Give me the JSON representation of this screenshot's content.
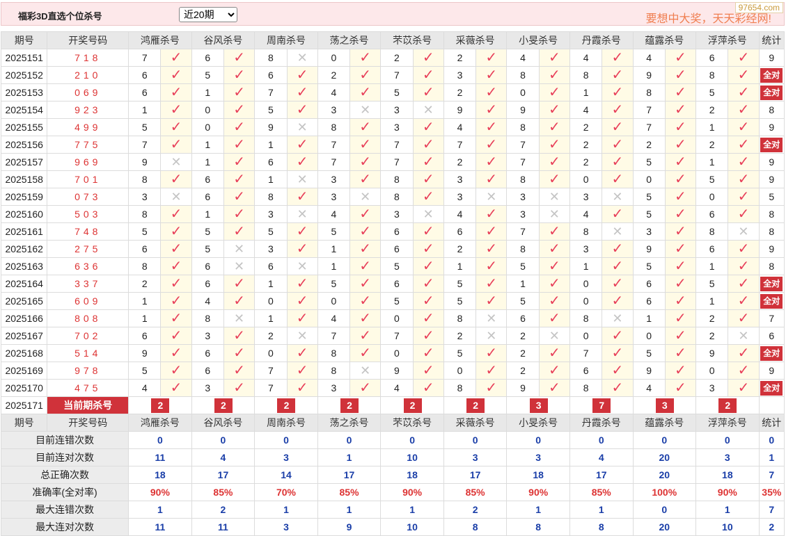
{
  "title": "福彩3D直选个位杀号",
  "period_select": "近20期",
  "period_options": [
    "近20期"
  ],
  "slogan": "要想中大奖，天天彩经网!",
  "watermark": "97654.com",
  "headers": [
    "期号",
    "开奖号码",
    "鸿雁杀号",
    "谷风杀号",
    "周南杀号",
    "荡之杀号",
    "芣苡杀号",
    "采薇杀号",
    "小旻杀号",
    "丹霞杀号",
    "蕴露杀号",
    "浮萍杀号",
    "统计"
  ],
  "all_correct_label": "全对",
  "rows": [
    {
      "p": "2025151",
      "n": "718",
      "k": [
        [
          7,
          1
        ],
        [
          6,
          1
        ],
        [
          8,
          0
        ],
        [
          0,
          1
        ],
        [
          2,
          1
        ],
        [
          2,
          1
        ],
        [
          4,
          1
        ],
        [
          4,
          1
        ],
        [
          4,
          1
        ],
        [
          6,
          1
        ]
      ],
      "s": "9"
    },
    {
      "p": "2025152",
      "n": "210",
      "k": [
        [
          6,
          1
        ],
        [
          5,
          1
        ],
        [
          6,
          1
        ],
        [
          2,
          1
        ],
        [
          7,
          1
        ],
        [
          3,
          1
        ],
        [
          8,
          1
        ],
        [
          8,
          1
        ],
        [
          9,
          1
        ],
        [
          8,
          1
        ]
      ],
      "s": "全对"
    },
    {
      "p": "2025153",
      "n": "069",
      "k": [
        [
          6,
          1
        ],
        [
          1,
          1
        ],
        [
          7,
          1
        ],
        [
          4,
          1
        ],
        [
          5,
          1
        ],
        [
          2,
          1
        ],
        [
          0,
          1
        ],
        [
          1,
          1
        ],
        [
          8,
          1
        ],
        [
          5,
          1
        ]
      ],
      "s": "全对"
    },
    {
      "p": "2025154",
      "n": "923",
      "k": [
        [
          1,
          1
        ],
        [
          0,
          1
        ],
        [
          5,
          1
        ],
        [
          3,
          0
        ],
        [
          3,
          0
        ],
        [
          9,
          1
        ],
        [
          9,
          1
        ],
        [
          4,
          1
        ],
        [
          7,
          1
        ],
        [
          2,
          1
        ]
      ],
      "s": "8"
    },
    {
      "p": "2025155",
      "n": "499",
      "k": [
        [
          5,
          1
        ],
        [
          0,
          1
        ],
        [
          9,
          0
        ],
        [
          8,
          1
        ],
        [
          3,
          1
        ],
        [
          4,
          1
        ],
        [
          8,
          1
        ],
        [
          2,
          1
        ],
        [
          7,
          1
        ],
        [
          1,
          1
        ]
      ],
      "s": "9"
    },
    {
      "p": "2025156",
      "n": "775",
      "k": [
        [
          7,
          1
        ],
        [
          1,
          1
        ],
        [
          1,
          1
        ],
        [
          7,
          1
        ],
        [
          7,
          1
        ],
        [
          7,
          1
        ],
        [
          7,
          1
        ],
        [
          2,
          1
        ],
        [
          2,
          1
        ],
        [
          2,
          1
        ]
      ],
      "s": "全对"
    },
    {
      "p": "2025157",
      "n": "969",
      "k": [
        [
          9,
          0
        ],
        [
          1,
          1
        ],
        [
          6,
          1
        ],
        [
          7,
          1
        ],
        [
          7,
          1
        ],
        [
          2,
          1
        ],
        [
          7,
          1
        ],
        [
          2,
          1
        ],
        [
          5,
          1
        ],
        [
          1,
          1
        ]
      ],
      "s": "9"
    },
    {
      "p": "2025158",
      "n": "701",
      "k": [
        [
          8,
          1
        ],
        [
          6,
          1
        ],
        [
          1,
          0
        ],
        [
          3,
          1
        ],
        [
          8,
          1
        ],
        [
          3,
          1
        ],
        [
          8,
          1
        ],
        [
          0,
          1
        ],
        [
          0,
          1
        ],
        [
          5,
          1
        ]
      ],
      "s": "9"
    },
    {
      "p": "2025159",
      "n": "073",
      "k": [
        [
          3,
          0
        ],
        [
          6,
          1
        ],
        [
          8,
          1
        ],
        [
          3,
          0
        ],
        [
          8,
          1
        ],
        [
          3,
          0
        ],
        [
          3,
          0
        ],
        [
          3,
          0
        ],
        [
          5,
          1
        ],
        [
          0,
          1
        ]
      ],
      "s": "5"
    },
    {
      "p": "2025160",
      "n": "503",
      "k": [
        [
          8,
          1
        ],
        [
          1,
          1
        ],
        [
          3,
          0
        ],
        [
          4,
          1
        ],
        [
          3,
          0
        ],
        [
          4,
          1
        ],
        [
          3,
          0
        ],
        [
          4,
          1
        ],
        [
          5,
          1
        ],
        [
          6,
          1
        ]
      ],
      "s": "8"
    },
    {
      "p": "2025161",
      "n": "748",
      "k": [
        [
          5,
          1
        ],
        [
          5,
          1
        ],
        [
          5,
          1
        ],
        [
          5,
          1
        ],
        [
          6,
          1
        ],
        [
          6,
          1
        ],
        [
          7,
          1
        ],
        [
          8,
          0
        ],
        [
          3,
          1
        ],
        [
          8,
          0
        ]
      ],
      "s": "8"
    },
    {
      "p": "2025162",
      "n": "275",
      "k": [
        [
          6,
          1
        ],
        [
          5,
          0
        ],
        [
          3,
          1
        ],
        [
          1,
          1
        ],
        [
          6,
          1
        ],
        [
          2,
          1
        ],
        [
          8,
          1
        ],
        [
          3,
          1
        ],
        [
          9,
          1
        ],
        [
          6,
          1
        ]
      ],
      "s": "9"
    },
    {
      "p": "2025163",
      "n": "636",
      "k": [
        [
          8,
          1
        ],
        [
          6,
          0
        ],
        [
          6,
          0
        ],
        [
          1,
          1
        ],
        [
          5,
          1
        ],
        [
          1,
          1
        ],
        [
          5,
          1
        ],
        [
          1,
          1
        ],
        [
          5,
          1
        ],
        [
          1,
          1
        ]
      ],
      "s": "8"
    },
    {
      "p": "2025164",
      "n": "337",
      "k": [
        [
          2,
          1
        ],
        [
          6,
          1
        ],
        [
          1,
          1
        ],
        [
          5,
          1
        ],
        [
          6,
          1
        ],
        [
          5,
          1
        ],
        [
          1,
          1
        ],
        [
          0,
          1
        ],
        [
          6,
          1
        ],
        [
          5,
          1
        ]
      ],
      "s": "全对"
    },
    {
      "p": "2025165",
      "n": "609",
      "k": [
        [
          1,
          1
        ],
        [
          4,
          1
        ],
        [
          0,
          1
        ],
        [
          0,
          1
        ],
        [
          5,
          1
        ],
        [
          5,
          1
        ],
        [
          5,
          1
        ],
        [
          0,
          1
        ],
        [
          6,
          1
        ],
        [
          1,
          1
        ]
      ],
      "s": "全对"
    },
    {
      "p": "2025166",
      "n": "808",
      "k": [
        [
          1,
          1
        ],
        [
          8,
          0
        ],
        [
          1,
          1
        ],
        [
          4,
          1
        ],
        [
          0,
          1
        ],
        [
          8,
          0
        ],
        [
          6,
          1
        ],
        [
          8,
          0
        ],
        [
          1,
          1
        ],
        [
          2,
          1
        ]
      ],
      "s": "7"
    },
    {
      "p": "2025167",
      "n": "702",
      "k": [
        [
          6,
          1
        ],
        [
          3,
          1
        ],
        [
          2,
          0
        ],
        [
          7,
          1
        ],
        [
          7,
          1
        ],
        [
          2,
          0
        ],
        [
          2,
          0
        ],
        [
          0,
          1
        ],
        [
          0,
          1
        ],
        [
          2,
          0
        ]
      ],
      "s": "6"
    },
    {
      "p": "2025168",
      "n": "514",
      "k": [
        [
          9,
          1
        ],
        [
          6,
          1
        ],
        [
          0,
          1
        ],
        [
          8,
          1
        ],
        [
          0,
          1
        ],
        [
          5,
          1
        ],
        [
          2,
          1
        ],
        [
          7,
          1
        ],
        [
          5,
          1
        ],
        [
          9,
          1
        ]
      ],
      "s": "全对"
    },
    {
      "p": "2025169",
      "n": "978",
      "k": [
        [
          5,
          1
        ],
        [
          6,
          1
        ],
        [
          7,
          1
        ],
        [
          8,
          0
        ],
        [
          9,
          1
        ],
        [
          0,
          1
        ],
        [
          2,
          1
        ],
        [
          6,
          1
        ],
        [
          9,
          1
        ],
        [
          0,
          1
        ]
      ],
      "s": "9"
    },
    {
      "p": "2025170",
      "n": "475",
      "k": [
        [
          4,
          1
        ],
        [
          3,
          1
        ],
        [
          7,
          1
        ],
        [
          3,
          1
        ],
        [
          4,
          1
        ],
        [
          8,
          1
        ],
        [
          9,
          1
        ],
        [
          8,
          1
        ],
        [
          4,
          1
        ],
        [
          3,
          1
        ]
      ],
      "s": "全对"
    }
  ],
  "current": {
    "p": "2025171",
    "label": "当前期杀号",
    "vals": [
      "2",
      "2",
      "2",
      "2",
      "2",
      "2",
      "3",
      "7",
      "3",
      "2"
    ]
  },
  "stats": [
    {
      "label": "目前连错次数",
      "v": [
        "0",
        "0",
        "0",
        "0",
        "0",
        "0",
        "0",
        "0",
        "0",
        "0",
        "0"
      ]
    },
    {
      "label": "目前连对次数",
      "v": [
        "11",
        "4",
        "3",
        "1",
        "10",
        "3",
        "3",
        "4",
        "20",
        "3",
        "1"
      ]
    },
    {
      "label": "总正确次数",
      "v": [
        "18",
        "17",
        "14",
        "17",
        "18",
        "17",
        "18",
        "17",
        "20",
        "18",
        "7"
      ]
    },
    {
      "label": "准确率(全对率)",
      "v": [
        "90%",
        "85%",
        "70%",
        "85%",
        "90%",
        "85%",
        "90%",
        "85%",
        "100%",
        "90%",
        "35%"
      ],
      "rate": true
    },
    {
      "label": "最大连错次数",
      "v": [
        "1",
        "2",
        "1",
        "1",
        "1",
        "2",
        "1",
        "1",
        "0",
        "1",
        "7"
      ]
    },
    {
      "label": "最大连对次数",
      "v": [
        "11",
        "11",
        "3",
        "9",
        "10",
        "8",
        "8",
        "8",
        "20",
        "10",
        "2"
      ]
    }
  ]
}
